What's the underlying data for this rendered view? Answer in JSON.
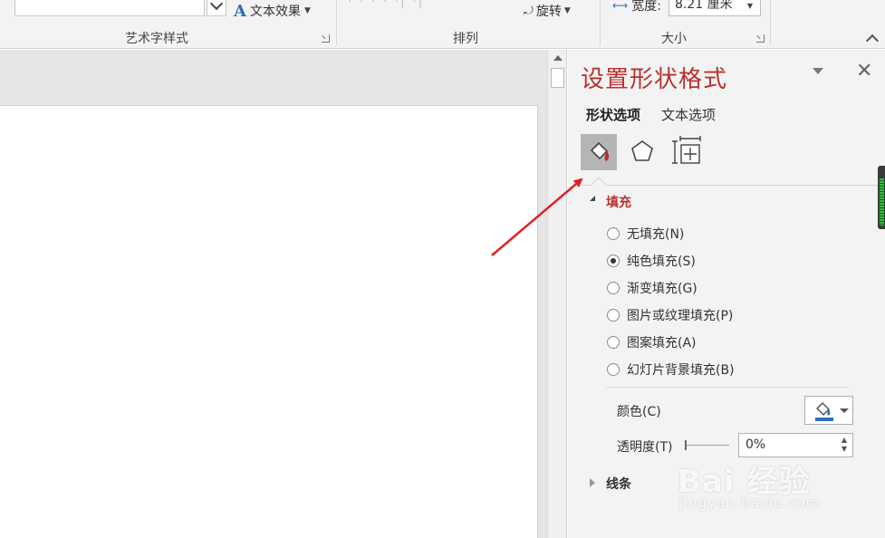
{
  "ribbon": {
    "wordart_styles_label": "艺术字样式",
    "text_effects_label": "文本效果",
    "arrange_label": "排列",
    "arrange_faded_text": "· ·  · ·  ·|  ·|",
    "rotate_label": "旋转",
    "size_label": "大小",
    "width_label": "宽度:",
    "width_value": "8.21 厘米"
  },
  "pane": {
    "title": "设置形状格式",
    "tabs": [
      "形状选项",
      "文本选项"
    ],
    "categories": [
      "fill-line-icon",
      "effects-pentagon-icon",
      "size-properties-icon"
    ],
    "fill_section": {
      "title": "填充",
      "expanded": true,
      "options": [
        {
          "label": "无填充(N)",
          "selected": false
        },
        {
          "label": "纯色填充(S)",
          "selected": true
        },
        {
          "label": "渐变填充(G)",
          "selected": false
        },
        {
          "label": "图片或纹理填充(P)",
          "selected": false
        },
        {
          "label": "图案填充(A)",
          "selected": false
        },
        {
          "label": "幻灯片背景填充(B)",
          "selected": false
        }
      ],
      "color_label": "颜色(C)",
      "transparency_label": "透明度(T)",
      "transparency_value": "0%"
    },
    "line_section": {
      "title": "线条",
      "expanded": false
    }
  },
  "watermark": {
    "brand": "Bai 经验",
    "url": "jingyan.baidu.com"
  },
  "colors": {
    "accent_title": "#b8312f",
    "annotation_arrow": "#e02020",
    "selected_category_bg": "#b5b5b5",
    "text_effect_icon": "#2f6fb8"
  }
}
